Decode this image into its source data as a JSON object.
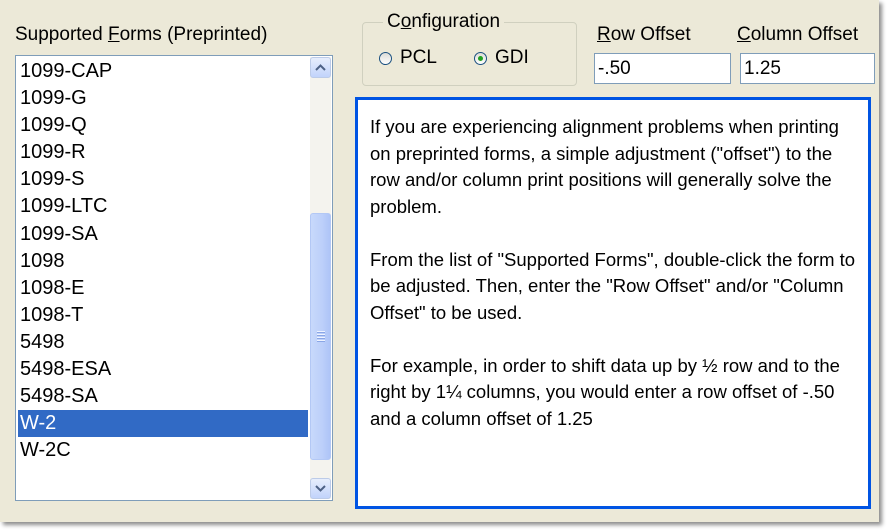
{
  "forms": {
    "label_prefix": "Supported ",
    "label_accel": "F",
    "label_rest": "orms (Preprinted)",
    "items": [
      "1099-CAP",
      "1099-G",
      "1099-Q",
      "1099-R",
      "1099-S",
      "1099-LTC",
      "1099-SA",
      "1098",
      "1098-E",
      "1098-T",
      "5498",
      "5498-ESA",
      "5498-SA",
      "W-2",
      "W-2C"
    ],
    "selected": "W-2"
  },
  "configuration": {
    "label_prefix": "C",
    "label_accel": "o",
    "label_rest": "nfiguration",
    "options": [
      "PCL",
      "GDI"
    ],
    "selected": "GDI"
  },
  "row_offset": {
    "label_accel": "R",
    "label_rest": "ow Offset",
    "value": "-.50"
  },
  "column_offset": {
    "label_accel": "C",
    "label_rest": "olumn Offset",
    "value": "1.25"
  },
  "help": {
    "paragraphs": [
      "If you are experiencing alignment problems when printing on preprinted forms, a simple adjustment (\"offset\") to the row and/or column print positions will generally solve the problem.",
      "From the list of \"Supported Forms\", double-click the form to be adjusted. Then, enter the \"Row Offset\" and/or \"Column Offset\" to be used.",
      "For example, in order to shift data up by ½ row and to the right by 1¼ columns, you would enter a row offset of -.50 and a column offset of 1.25"
    ]
  },
  "icons": {
    "scroll_up": "scroll-up-arrow-icon",
    "scroll_down": "scroll-down-arrow-icon",
    "scroll_grip": "scroll-grip-icon"
  },
  "colors": {
    "panel_bg": "#ece9d8",
    "selection": "#316ac5",
    "help_border": "#0054e3",
    "radio_dot": "#21a121"
  }
}
